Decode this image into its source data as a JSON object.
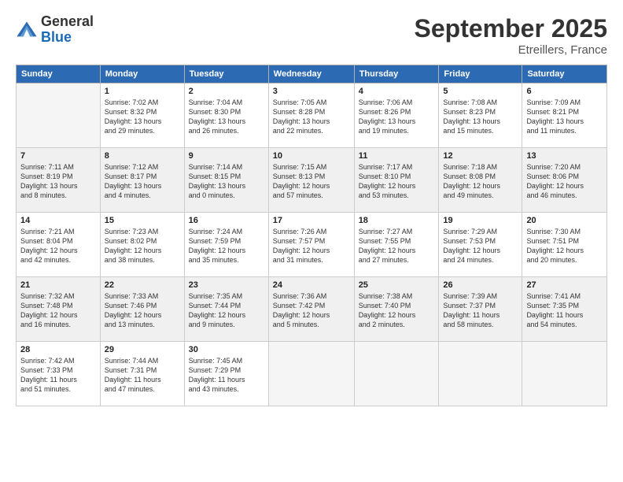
{
  "logo": {
    "general": "General",
    "blue": "Blue"
  },
  "header": {
    "month": "September 2025",
    "location": "Etreillers, France"
  },
  "weekdays": [
    "Sunday",
    "Monday",
    "Tuesday",
    "Wednesday",
    "Thursday",
    "Friday",
    "Saturday"
  ],
  "weeks": [
    [
      {
        "day": "",
        "info": ""
      },
      {
        "day": "1",
        "info": "Sunrise: 7:02 AM\nSunset: 8:32 PM\nDaylight: 13 hours\nand 29 minutes."
      },
      {
        "day": "2",
        "info": "Sunrise: 7:04 AM\nSunset: 8:30 PM\nDaylight: 13 hours\nand 26 minutes."
      },
      {
        "day": "3",
        "info": "Sunrise: 7:05 AM\nSunset: 8:28 PM\nDaylight: 13 hours\nand 22 minutes."
      },
      {
        "day": "4",
        "info": "Sunrise: 7:06 AM\nSunset: 8:26 PM\nDaylight: 13 hours\nand 19 minutes."
      },
      {
        "day": "5",
        "info": "Sunrise: 7:08 AM\nSunset: 8:23 PM\nDaylight: 13 hours\nand 15 minutes."
      },
      {
        "day": "6",
        "info": "Sunrise: 7:09 AM\nSunset: 8:21 PM\nDaylight: 13 hours\nand 11 minutes."
      }
    ],
    [
      {
        "day": "7",
        "info": "Sunrise: 7:11 AM\nSunset: 8:19 PM\nDaylight: 13 hours\nand 8 minutes."
      },
      {
        "day": "8",
        "info": "Sunrise: 7:12 AM\nSunset: 8:17 PM\nDaylight: 13 hours\nand 4 minutes."
      },
      {
        "day": "9",
        "info": "Sunrise: 7:14 AM\nSunset: 8:15 PM\nDaylight: 13 hours\nand 0 minutes."
      },
      {
        "day": "10",
        "info": "Sunrise: 7:15 AM\nSunset: 8:13 PM\nDaylight: 12 hours\nand 57 minutes."
      },
      {
        "day": "11",
        "info": "Sunrise: 7:17 AM\nSunset: 8:10 PM\nDaylight: 12 hours\nand 53 minutes."
      },
      {
        "day": "12",
        "info": "Sunrise: 7:18 AM\nSunset: 8:08 PM\nDaylight: 12 hours\nand 49 minutes."
      },
      {
        "day": "13",
        "info": "Sunrise: 7:20 AM\nSunset: 8:06 PM\nDaylight: 12 hours\nand 46 minutes."
      }
    ],
    [
      {
        "day": "14",
        "info": "Sunrise: 7:21 AM\nSunset: 8:04 PM\nDaylight: 12 hours\nand 42 minutes."
      },
      {
        "day": "15",
        "info": "Sunrise: 7:23 AM\nSunset: 8:02 PM\nDaylight: 12 hours\nand 38 minutes."
      },
      {
        "day": "16",
        "info": "Sunrise: 7:24 AM\nSunset: 7:59 PM\nDaylight: 12 hours\nand 35 minutes."
      },
      {
        "day": "17",
        "info": "Sunrise: 7:26 AM\nSunset: 7:57 PM\nDaylight: 12 hours\nand 31 minutes."
      },
      {
        "day": "18",
        "info": "Sunrise: 7:27 AM\nSunset: 7:55 PM\nDaylight: 12 hours\nand 27 minutes."
      },
      {
        "day": "19",
        "info": "Sunrise: 7:29 AM\nSunset: 7:53 PM\nDaylight: 12 hours\nand 24 minutes."
      },
      {
        "day": "20",
        "info": "Sunrise: 7:30 AM\nSunset: 7:51 PM\nDaylight: 12 hours\nand 20 minutes."
      }
    ],
    [
      {
        "day": "21",
        "info": "Sunrise: 7:32 AM\nSunset: 7:48 PM\nDaylight: 12 hours\nand 16 minutes."
      },
      {
        "day": "22",
        "info": "Sunrise: 7:33 AM\nSunset: 7:46 PM\nDaylight: 12 hours\nand 13 minutes."
      },
      {
        "day": "23",
        "info": "Sunrise: 7:35 AM\nSunset: 7:44 PM\nDaylight: 12 hours\nand 9 minutes."
      },
      {
        "day": "24",
        "info": "Sunrise: 7:36 AM\nSunset: 7:42 PM\nDaylight: 12 hours\nand 5 minutes."
      },
      {
        "day": "25",
        "info": "Sunrise: 7:38 AM\nSunset: 7:40 PM\nDaylight: 12 hours\nand 2 minutes."
      },
      {
        "day": "26",
        "info": "Sunrise: 7:39 AM\nSunset: 7:37 PM\nDaylight: 11 hours\nand 58 minutes."
      },
      {
        "day": "27",
        "info": "Sunrise: 7:41 AM\nSunset: 7:35 PM\nDaylight: 11 hours\nand 54 minutes."
      }
    ],
    [
      {
        "day": "28",
        "info": "Sunrise: 7:42 AM\nSunset: 7:33 PM\nDaylight: 11 hours\nand 51 minutes."
      },
      {
        "day": "29",
        "info": "Sunrise: 7:44 AM\nSunset: 7:31 PM\nDaylight: 11 hours\nand 47 minutes."
      },
      {
        "day": "30",
        "info": "Sunrise: 7:45 AM\nSunset: 7:29 PM\nDaylight: 11 hours\nand 43 minutes."
      },
      {
        "day": "",
        "info": ""
      },
      {
        "day": "",
        "info": ""
      },
      {
        "day": "",
        "info": ""
      },
      {
        "day": "",
        "info": ""
      }
    ]
  ]
}
